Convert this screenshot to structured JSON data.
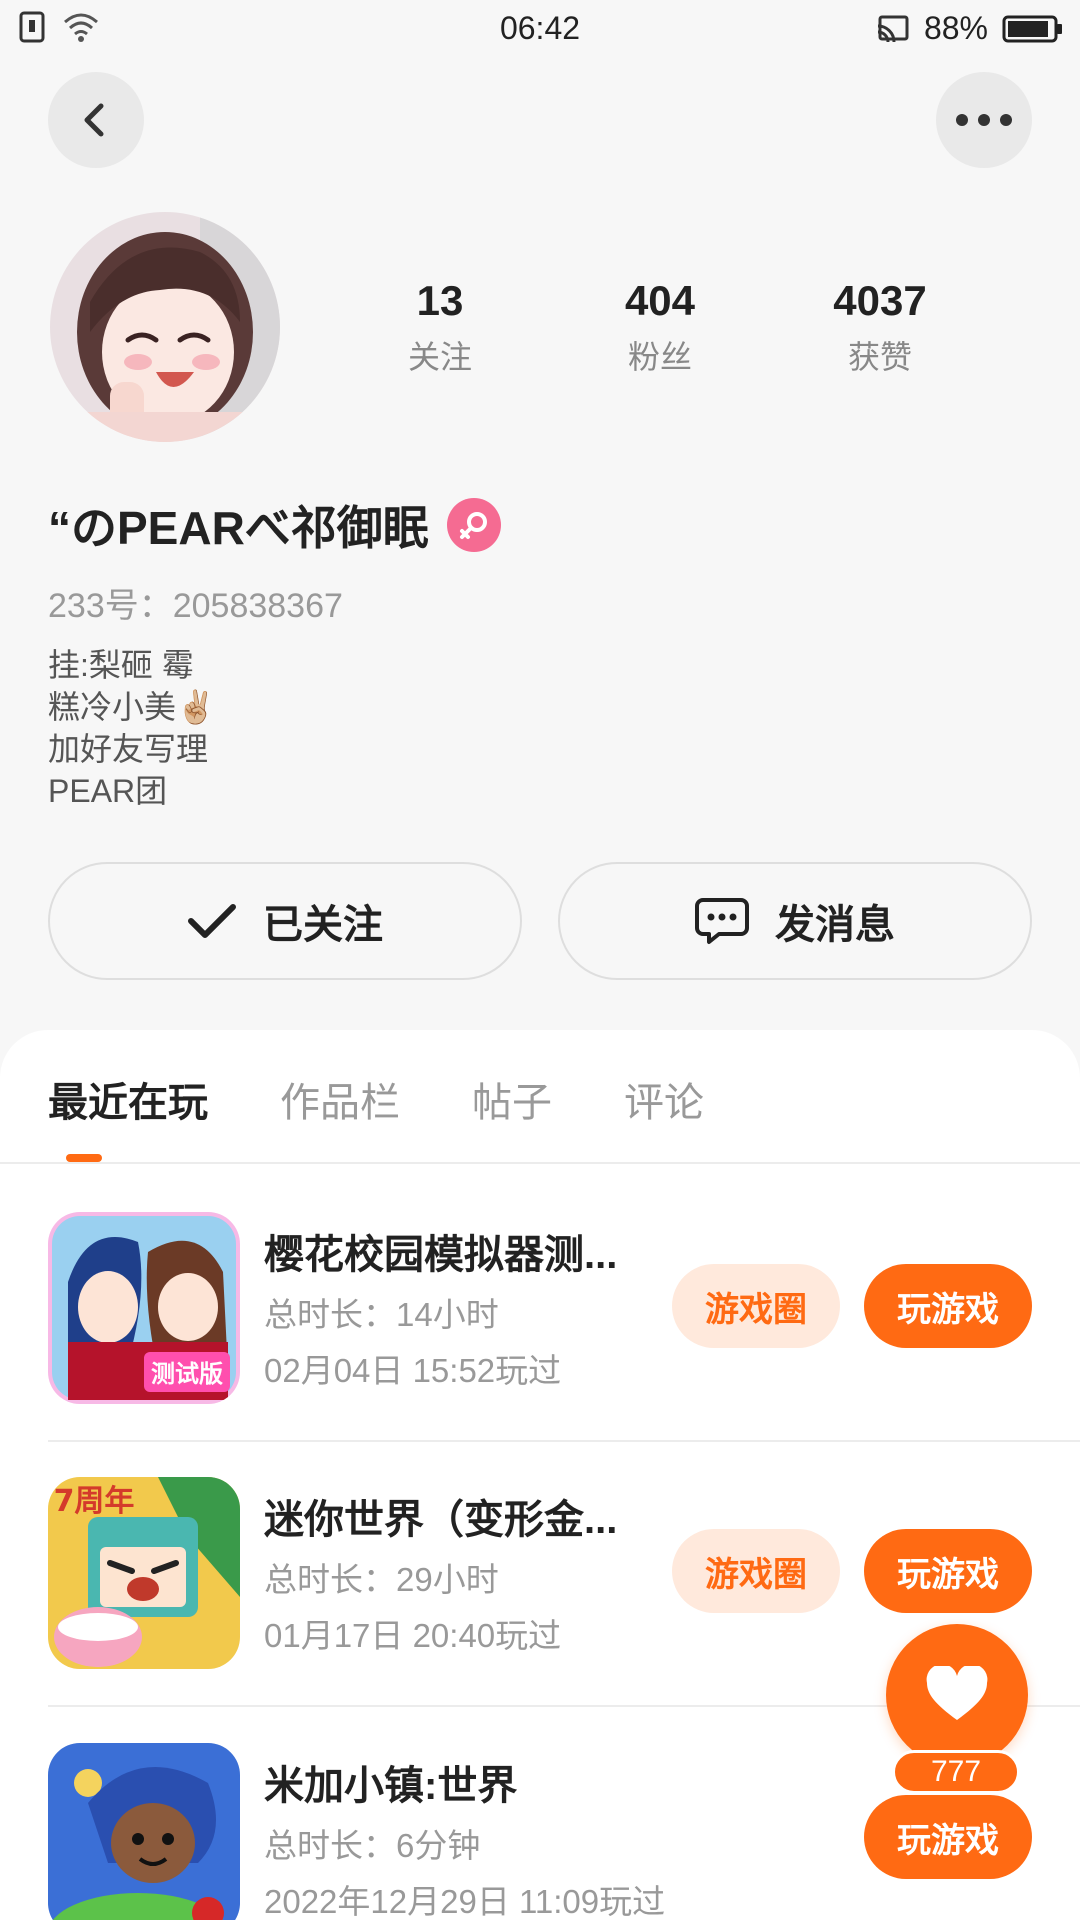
{
  "status_bar": {
    "time": "06:42",
    "battery": "88%"
  },
  "profile": {
    "stats": [
      {
        "value": "13",
        "label": "关注"
      },
      {
        "value": "404",
        "label": "粉丝"
      },
      {
        "value": "4037",
        "label": "获赞"
      }
    ],
    "username": "“のPEARべ祁御眠",
    "user_id": "233号：205838367",
    "bio": [
      "挂:梨砸 霉",
      "糕冷小美✌🏼",
      "加好友写理",
      "PEAR团"
    ],
    "follow_label": "已关注",
    "message_label": "发消息"
  },
  "tabs": [
    {
      "label": "最近在玩"
    },
    {
      "label": "作品栏"
    },
    {
      "label": "帖子"
    },
    {
      "label": "评论"
    }
  ],
  "games": [
    {
      "title": "樱花校园模拟器测...",
      "duration": "总时长：14小时",
      "last_played": "02月04日 15:52玩过",
      "circle_label": "游戏圈",
      "play_label": "玩游戏",
      "icon_text": "测试版"
    },
    {
      "title": "迷你世界（变形金...",
      "duration": "总时长：29小时",
      "last_played": "01月17日 20:40玩过",
      "circle_label": "游戏圈",
      "play_label": "玩游戏",
      "icon_text": "7周年"
    },
    {
      "title": "米加小镇:世界",
      "duration": "总时长：6分钟",
      "last_played": "2022年12月29日 11:09玩过",
      "play_label": "玩游戏"
    }
  ],
  "floating_like": {
    "count": "777"
  },
  "colors": {
    "accent": "#ff6a13",
    "accent_light": "#ffe9dc",
    "gender": "#f56b92"
  },
  "icons": [
    "back-arrow-icon",
    "more-dots-icon",
    "female-icon",
    "check-icon",
    "chat-bubble-icon",
    "heart-icon",
    "wifi-icon",
    "cast-icon",
    "battery-icon"
  ]
}
